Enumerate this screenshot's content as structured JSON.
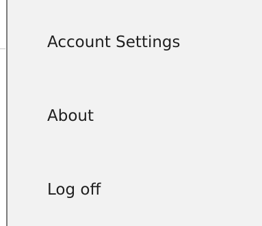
{
  "menu": {
    "items": [
      {
        "label": "Account Settings"
      },
      {
        "label": "About"
      },
      {
        "label": "Log off"
      }
    ]
  },
  "colors": {
    "menu_background": "#f2f2f2",
    "text": "#1f1f1f",
    "border": "#7a7a7a"
  }
}
